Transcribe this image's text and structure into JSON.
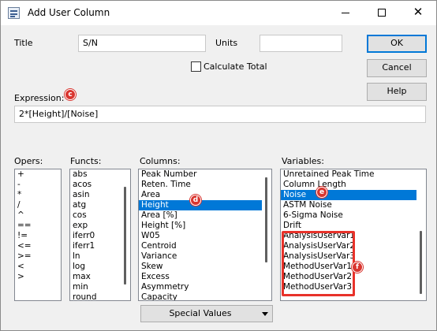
{
  "window": {
    "title": "Add User Column",
    "controls": {
      "minimize": "minimize",
      "maximize": "maximize",
      "close": "✕"
    }
  },
  "fields": {
    "title_label": "Title",
    "title_value": "S/N",
    "units_label": "Units",
    "units_value": "",
    "calculate_total_label": "Calculate Total",
    "calculate_total_checked": false,
    "expression_label": "Expression:",
    "expression_value": "2*[Height]/[Noise]"
  },
  "buttons": {
    "ok": "OK",
    "cancel": "Cancel",
    "help": "Help"
  },
  "markers": {
    "c": "c",
    "d": "d",
    "e": "e",
    "f": "f"
  },
  "opers": {
    "label": "Opers:",
    "items": [
      "+",
      "-",
      "*",
      "/",
      "^",
      "==",
      "!=",
      "<=",
      ">=",
      "<",
      ">"
    ]
  },
  "functs": {
    "label": "Functs:",
    "items": [
      "abs",
      "acos",
      "asin",
      "atg",
      "cos",
      "exp",
      "iferr0",
      "iferr1",
      "ln",
      "log",
      "max",
      "min",
      "round"
    ]
  },
  "columns": {
    "label": "Columns:",
    "items": [
      "Peak Number",
      "Reten. Time",
      "Area",
      "Height",
      "Area [%]",
      "Height [%]",
      "W05",
      "Centroid",
      "Variance",
      "Skew",
      "Excess",
      "Asymmetry",
      "Capacity"
    ],
    "selected": "Height"
  },
  "variables": {
    "label": "Variables:",
    "items": [
      "Unretained Peak Time",
      "Column Length",
      "Noise",
      "ASTM Noise",
      "6-Sigma Noise",
      "Drift",
      "AnalysisUserVar1",
      "AnalysisUserVar2",
      "AnalysisUserVar3",
      "MethodUserVar1",
      "MethodUserVar2",
      "MethodUserVar3"
    ],
    "selected": "Noise"
  },
  "special_values": {
    "label": "Special Values"
  },
  "colors": {
    "accent": "#0078d7",
    "marker_red": "#d9352f",
    "highlight_red": "#e8322a"
  }
}
